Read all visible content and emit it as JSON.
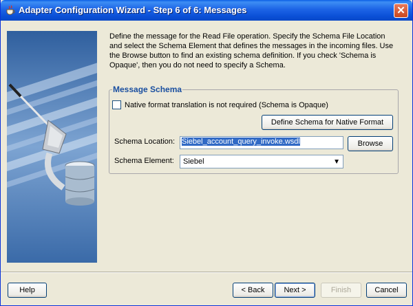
{
  "window": {
    "title": "Adapter Configuration Wizard - Step 6 of 6: Messages"
  },
  "description": "Define the message for the Read File operation.  Specify the Schema File Location and select the Schema Element that defines the messages in the incoming files. Use the Browse button to find an existing schema definition. If you check 'Schema is Opaque', then you do not need to specify a Schema.",
  "schema_group": {
    "legend": "Message Schema",
    "opaque_checkbox": {
      "label": "Native format translation is not required (Schema is Opaque)",
      "checked": false
    },
    "define_button": "Define Schema for Native Format",
    "location_label": "Schema Location:",
    "location_value": "Siebel_account_query_invoke.wsdl",
    "browse_button": "Browse",
    "element_label": "Schema Element:",
    "element_value": "Siebel"
  },
  "buttons": {
    "help": "Help",
    "back": "< Back",
    "next": "Next >",
    "finish": "Finish",
    "cancel": "Cancel"
  },
  "colors": {
    "titlebar": "#0a4fd6",
    "legend": "#1a4fa0",
    "selection": "#316ac5"
  }
}
